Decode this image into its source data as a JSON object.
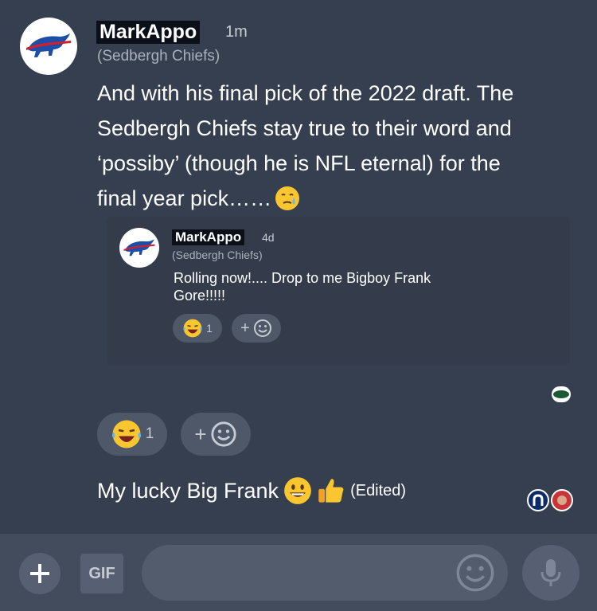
{
  "main_post": {
    "username": "MarkAppo",
    "time": "1m",
    "team": "(Sedbergh Chiefs)",
    "message_lines": [
      "And with his final pick of the 2022 draft. The",
      "Sedbergh Chiefs stay true to their word and",
      "‘possiby’ (though he is NFL eternal) for the",
      "final year pick……"
    ],
    "reaction_count": "1",
    "add_reaction_label": "+"
  },
  "quoted_post": {
    "username": "MarkAppo",
    "time": "4d",
    "team": "(Sedbergh Chiefs)",
    "message_lines": [
      "Rolling now!.... Drop to me Bigboy Frank",
      "Gore!!!!!"
    ],
    "reaction_count": "1",
    "add_reaction_label": "+"
  },
  "reply": {
    "text": "My lucky Big Frank",
    "edited_label": "(Edited)"
  },
  "composer": {
    "gif_label": "GIF",
    "placeholder": ""
  },
  "colors": {
    "background": "#363f4f",
    "bills_blue": "#1d4fa8",
    "bills_red": "#d0202f",
    "emoji_yellow": "#f9c630"
  },
  "icons": {
    "add": "plus-icon",
    "gif": "gif-icon",
    "emoji": "smiley-icon",
    "mic": "microphone-icon"
  }
}
